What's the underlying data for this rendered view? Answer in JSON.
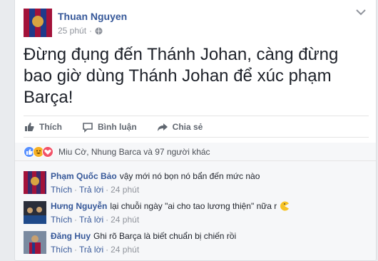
{
  "post": {
    "author": "Thuan Nguyen",
    "time": "25 phút",
    "separator": "·",
    "text": "Đừng đụng đến Thánh Johan, càng đừng bao giờ dùng Thánh Johan để xúc phạm Barça!"
  },
  "actions": {
    "like": "Thích",
    "comment": "Bình luận",
    "share": "Chia sẻ"
  },
  "reactions": {
    "summary": "Miu Cờ, Nhung Barca và 97 người khác",
    "types": [
      "like-icon",
      "haha-icon",
      "love-icon"
    ]
  },
  "comments": [
    {
      "name": "Phạm Quốc Bảo",
      "text": "vậy mới nó bọn nó bẩn đến mức nào",
      "like": "Thích",
      "reply": "Trả lời",
      "time": "24 phút"
    },
    {
      "name": "Hưng Nguyễn",
      "text": "lại chuỗi ngày \"ai cho tao lương thiện\" nữa r",
      "like": "Thích",
      "reply": "Trả lời",
      "time": "24 phút"
    },
    {
      "name": "Đăng Huy",
      "text": "Ghi rõ Barça là biết chuẩn bị chiến rồi",
      "like": "Thích",
      "reply": "Trả lời",
      "time": "24 phút"
    }
  ],
  "colors": {
    "link": "#365899",
    "muted": "#90949c",
    "background": "#e9ebee"
  }
}
